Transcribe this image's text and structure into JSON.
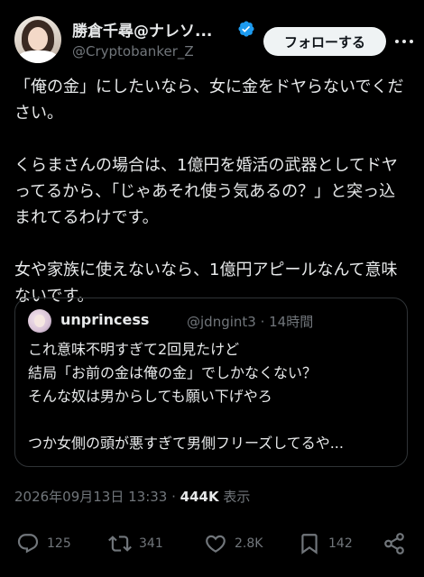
{
  "author": {
    "display_name": "勝倉千尋@ナレソ...",
    "handle": "@Cryptobanker_Z",
    "verified_icon": "verified-badge-icon",
    "follow_label": "フォローする",
    "more_icon": "more-dots-icon"
  },
  "tweet": {
    "text": "「俺の金」にしたいなら、女に金をドヤらないでください。\n\nくらまさんの場合は、1億円を婚活の武器としてドヤってるから、「じゃあそれ使う気あるの？」と突っ込まれてるわけです。\n\n女や家族に使えないなら、1億円アピールなんて意味ないです。"
  },
  "quote": {
    "name": "unprincess",
    "meta": "@jdngint3 · 14時間",
    "text": "これ意味不明すぎて2回見たけど\n結局「お前の金は俺の金」でしかなくない？\nそんな奴は男からしても願い下げやろ\n\nつか女側の頭が悪すぎて男側フリーズしてるや..."
  },
  "meta": {
    "timestamp": "2026年09月13日 13:33",
    "separator": " · ",
    "views": "444K",
    "views_label": " 表示"
  },
  "actions": {
    "reply_count": "125",
    "retweet_count": "341",
    "like_count": "2.8K",
    "bookmark_count": "142"
  },
  "colors": {
    "background": "#000000",
    "text": "#e7e9ea",
    "muted": "#71767b",
    "verified": "#1d9bf0",
    "border": "#2f3336"
  }
}
